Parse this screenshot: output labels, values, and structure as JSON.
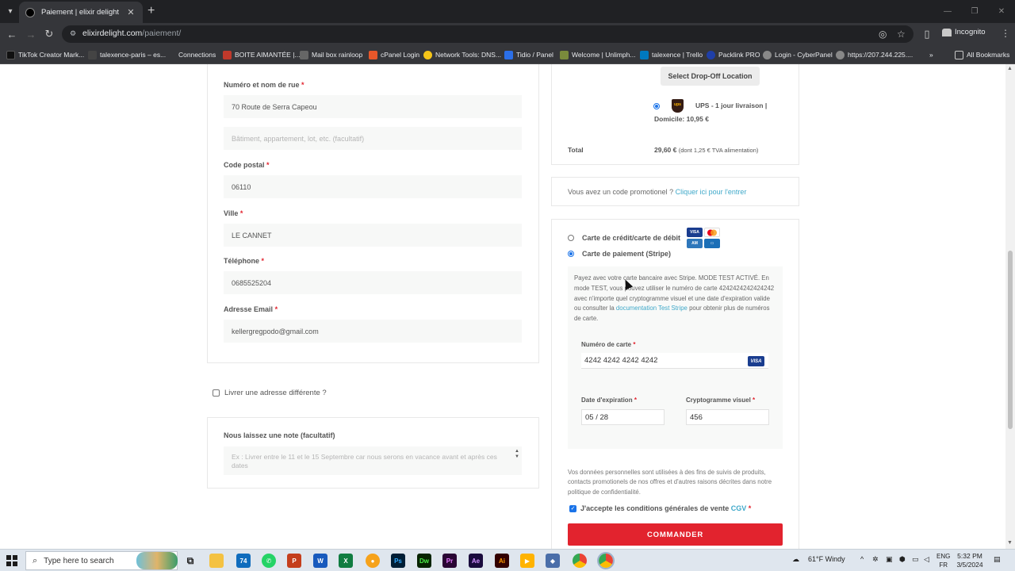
{
  "browser": {
    "tab_title": "Paiement | elixir delight",
    "url_host": "elixirdelight.com",
    "url_path": "/paiement/",
    "incognito_label": "Incognito",
    "bookmarks": [
      "TikTok Creator Mark...",
      "talexence-paris – es...",
      "Connections",
      "BOITE AIMANTÉE |...",
      "Mail box rainloop",
      "cPanel Login",
      "Network Tools: DNS...",
      "Tidio / Panel",
      "Welcome | Unlimph...",
      "talexence | Trello",
      "Packlink PRO",
      "Login - CyberPanel",
      "https://207.244.225...."
    ],
    "all_bookmarks": "All Bookmarks"
  },
  "billing": {
    "street_label": "Numéro et nom de rue",
    "street_value": "70 Route de Serra Capeou",
    "street2_placeholder": "Bâtiment, appartement, lot, etc. (facultatif)",
    "postcode_label": "Code postal",
    "postcode_value": "06110",
    "city_label": "Ville",
    "city_value": "LE CANNET",
    "phone_label": "Téléphone",
    "phone_value": "0685525204",
    "email_label": "Adresse Email",
    "email_value": "kellergregpodo@gmail.com",
    "required_mark": "*"
  },
  "ship_different_label": "Livrer une adresse différente ?",
  "note": {
    "label": "Nous laissez une note (facultatif)",
    "placeholder": "Ex : Livrer entre le 11 et le 15 Septembre car nous serons en vacance avant et après ces dates"
  },
  "order": {
    "dropoff_button": "Select Drop-Off Location",
    "ups_label": "UPS - 1 jour livraison |",
    "ups_price": "Domicile: 10,95 €",
    "ups_logo_text": "ups",
    "total_label": "Total",
    "total_value": "29,60 €",
    "total_tax": "(dont 1,25 € TVA alimentation)"
  },
  "promo": {
    "text": "Vous avez un code promotionel ?",
    "link": "Cliquer ici pour l'entrer"
  },
  "payment": {
    "option_card": "Carte de crédit/carte de débit",
    "option_stripe": "Carte de paiement (Stripe)",
    "selected": "stripe",
    "stripe_desc_1": "Payez avec votre carte bancaire avec Stripe. MODE TEST ACTIVÉ. En mode TEST, vous pouvez utiliser le numéro de carte 4242424242424242 avec n'importe quel cryptogramme visuel et une date d'expiration valide ou consulter la",
    "stripe_desc_link": "documentation Test Stripe",
    "stripe_desc_2": "pour obtenir plus de numéros de carte.",
    "card_number_label": "Numéro de carte",
    "card_number_value": "4242 4242 4242 4242",
    "card_brand": "VISA",
    "expiry_label": "Date d'expiration",
    "expiry_value": "05 / 28",
    "cvc_label": "Cryptogramme visuel",
    "cvc_value": "456"
  },
  "privacy_text": "Vos données personnelles sont utilisées à des fins de suivis de produits, contacts promotionels de nos offres et d'autres raisons décrites dans notre politique de confidentialité.",
  "terms": {
    "text": "J'accepte les conditions générales de vente",
    "link": "CGV",
    "checked": true
  },
  "submit_label": "COMMANDER",
  "taskbar": {
    "search_placeholder": "Type here to search",
    "weather": "61°F  Windy",
    "lang_top": "ENG",
    "lang_bottom": "FR",
    "time": "5:32 PM",
    "date": "3/5/2024",
    "outlook_badge": "74"
  },
  "colors": {
    "accent_red": "#e2232e",
    "link_blue": "#3ea8c9",
    "input_bg": "#f7f8f7"
  }
}
